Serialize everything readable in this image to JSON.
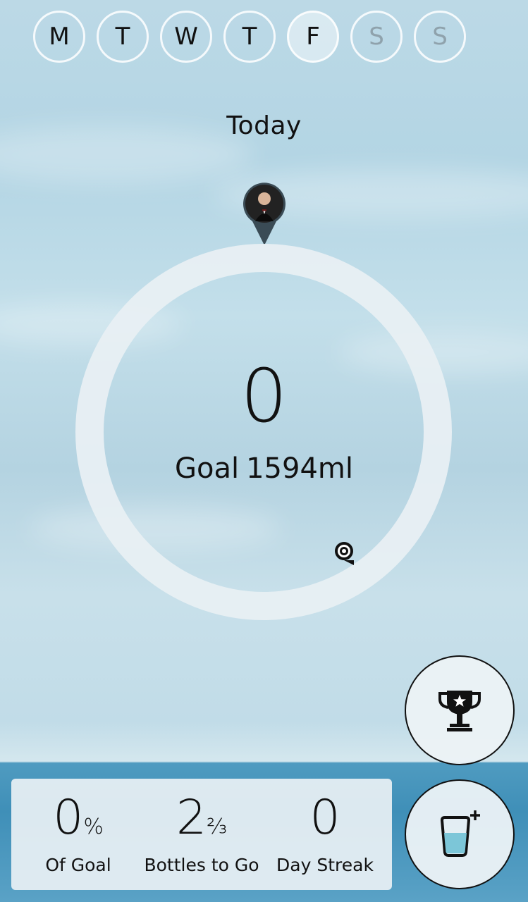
{
  "week": {
    "days": [
      {
        "letter": "M",
        "state": "past"
      },
      {
        "letter": "T",
        "state": "past"
      },
      {
        "letter": "W",
        "state": "past"
      },
      {
        "letter": "T",
        "state": "past"
      },
      {
        "letter": "F",
        "state": "current"
      },
      {
        "letter": "S",
        "state": "future"
      },
      {
        "letter": "S",
        "state": "future"
      }
    ]
  },
  "progress": {
    "label": "Today",
    "count": "0",
    "goal_prefix": "Goal",
    "goal_value": "1594ml",
    "fraction": 0
  },
  "stats": {
    "percent_value": "0",
    "percent_suffix": "%",
    "percent_label": "Of Goal",
    "bottles_value": "2",
    "bottles_fraction": "⅔",
    "bottles_label": "Bottles to Go",
    "streak_value": "0",
    "streak_label": "Day Streak"
  },
  "actions": {
    "trophy_icon": "trophy-icon",
    "add_drink_icon": "add-drink-icon"
  },
  "colors": {
    "ring": "#e8eff3",
    "water": "#7cc6d8",
    "panel": "#e8f0f4"
  }
}
